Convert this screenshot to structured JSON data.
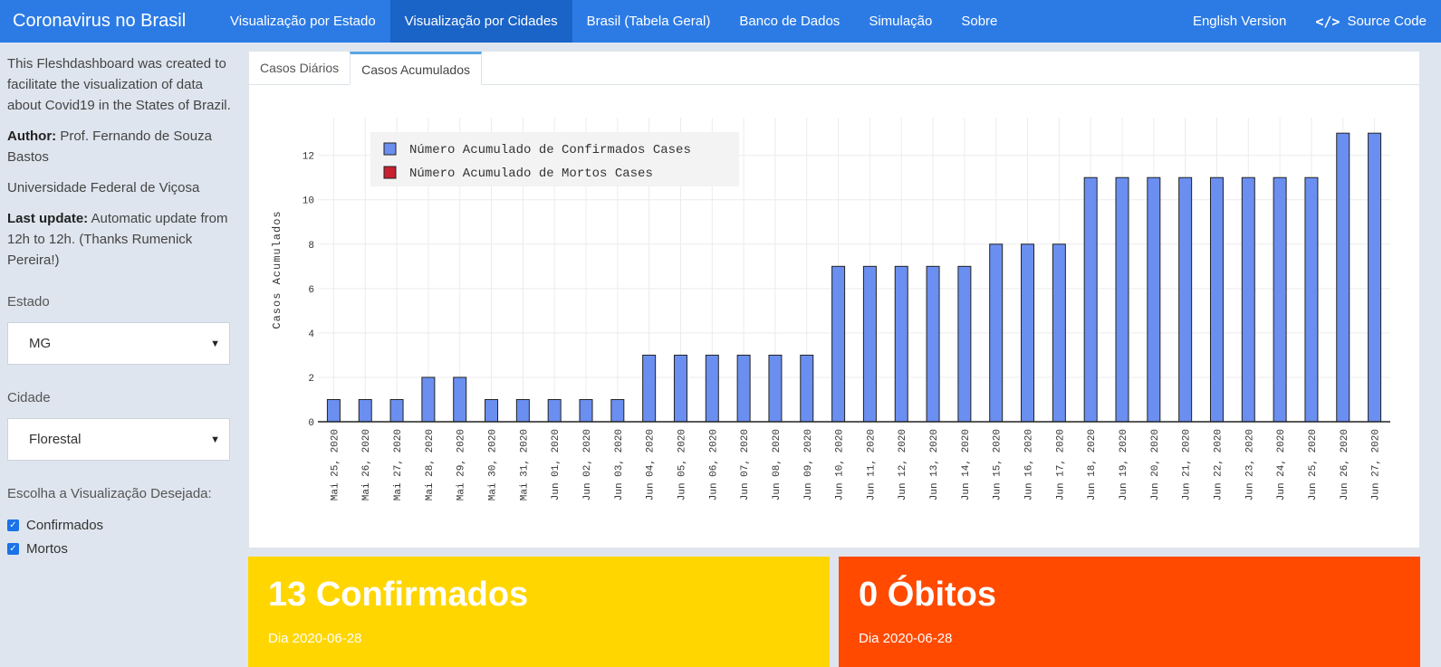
{
  "navbar": {
    "brand": "Coronavirus no Brasil",
    "items": [
      "Visualização por Estado",
      "Visualização por Cidades",
      "Brasil (Tabela Geral)",
      "Banco de Dados",
      "Simulação",
      "Sobre"
    ],
    "english": "English Version",
    "source_code": "Source Code"
  },
  "sidebar": {
    "intro": "This Fleshdashboard was created to facilitate the visualization of data about Covid19 in the States of Brazil.",
    "author_label": "Author:",
    "author_name": "Prof. Fernando de Souza Bastos",
    "university": "Universidade Federal de Viçosa",
    "update_label": "Last update:",
    "update_text": "Automatic update from 12h to 12h. (Thanks Rumenick Pereira!)",
    "estado_label": "Estado",
    "estado_value": "MG",
    "cidade_label": "Cidade",
    "cidade_value": "Florestal",
    "view_label": "Escolha a Visualização Desejada:",
    "check_confirmados": "Confirmados",
    "check_mortos": "Mortos"
  },
  "tabs": [
    "Casos Diários",
    "Casos Acumulados"
  ],
  "chart_data": {
    "type": "bar",
    "ylabel": "Casos Acumulados",
    "categories": [
      "Mai 25, 2020",
      "Mai 26, 2020",
      "Mai 27, 2020",
      "Mai 28, 2020",
      "Mai 29, 2020",
      "Mai 30, 2020",
      "Mai 31, 2020",
      "Jun 01, 2020",
      "Jun 02, 2020",
      "Jun 03, 2020",
      "Jun 04, 2020",
      "Jun 05, 2020",
      "Jun 06, 2020",
      "Jun 07, 2020",
      "Jun 08, 2020",
      "Jun 09, 2020",
      "Jun 10, 2020",
      "Jun 11, 2020",
      "Jun 12, 2020",
      "Jun 13, 2020",
      "Jun 14, 2020",
      "Jun 15, 2020",
      "Jun 16, 2020",
      "Jun 17, 2020",
      "Jun 18, 2020",
      "Jun 19, 2020",
      "Jun 20, 2020",
      "Jun 21, 2020",
      "Jun 22, 2020",
      "Jun 23, 2020",
      "Jun 24, 2020",
      "Jun 25, 2020",
      "Jun 26, 2020",
      "Jun 27, 2020"
    ],
    "series": [
      {
        "name": "Número Acumulado de Confirmados Cases",
        "color": "#6a8ff0",
        "values": [
          1,
          1,
          1,
          2,
          2,
          1,
          1,
          1,
          1,
          1,
          3,
          3,
          3,
          3,
          3,
          3,
          7,
          7,
          7,
          7,
          7,
          8,
          8,
          8,
          11,
          11,
          11,
          11,
          11,
          11,
          11,
          11,
          13,
          13
        ]
      },
      {
        "name": "Número Acumulado de Mortos Cases",
        "color": "#c8202f",
        "values": [
          0,
          0,
          0,
          0,
          0,
          0,
          0,
          0,
          0,
          0,
          0,
          0,
          0,
          0,
          0,
          0,
          0,
          0,
          0,
          0,
          0,
          0,
          0,
          0,
          0,
          0,
          0,
          0,
          0,
          0,
          0,
          0,
          0,
          0
        ]
      }
    ],
    "yticks": [
      0,
      2,
      4,
      6,
      8,
      10,
      12
    ],
    "ylim": [
      0,
      13.7
    ],
    "legend_position": "top-left",
    "grid": true
  },
  "boxes": {
    "confirmed_title": "13 Confirmados",
    "confirmed_sub": "Dia 2020-06-28",
    "deaths_title": "0 Óbitos",
    "deaths_sub": "Dia 2020-06-28"
  }
}
